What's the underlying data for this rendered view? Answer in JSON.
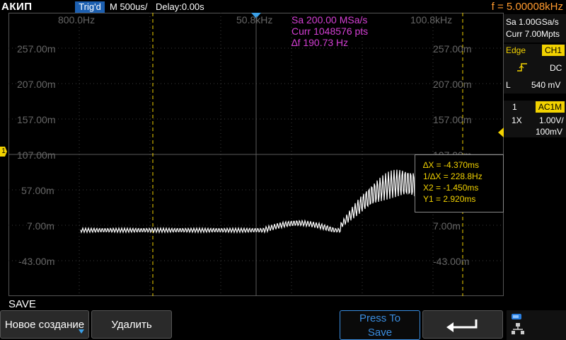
{
  "brand": "АКИП",
  "status": {
    "trig": "Trig'd",
    "timebase": "M 500us/",
    "delay": "Delay:0.00s",
    "freq": "f = 5.00008kHz"
  },
  "fft": {
    "x_labels": [
      "800.0Hz",
      "50.8kHz",
      "100.8kHz"
    ],
    "y_labels_left": [
      "257.00m",
      "207.00m",
      "157.00m",
      "107.00m",
      "57.00m",
      "7.00m",
      "-43.00m"
    ],
    "y_labels_right": [
      "257.00m",
      "207.00m",
      "157.00m",
      "107.00m",
      "57.00m",
      "7.00m",
      "-43.00m"
    ],
    "sa": "Sa 200.00 MSa/s",
    "curr": "Curr 1048576 pts",
    "df": "∆f 190.73 Hz",
    "trace_color": "#ffffff"
  },
  "channel_marker": "1",
  "right_panel": {
    "sa": "Sa 1.00GSa/s",
    "curr": "Curr 7.00Mpts",
    "edge_label": "Edge",
    "edge_channel": "CH1",
    "coupling": "DC",
    "level_label": "L",
    "level_value": "540 mV",
    "ch_number": "1",
    "ch_coupling": "AC1M",
    "probe": "1X",
    "volts_div": "1.00V/",
    "offset": "100mV"
  },
  "cursors": {
    "dx": "∆X = -4.370ms",
    "inv_dx": "1/∆X = 228.8Hz",
    "x2": "X2 = -1.450ms",
    "y1": "Y1 = 2.920ms"
  },
  "menu": {
    "title": "SAVE",
    "new_label": "Новое создание",
    "delete_label": "Удалить",
    "press_to_save_line1": "Press To",
    "press_to_save_line2": "Save",
    "back_icon": "return-arrow-icon",
    "network_icon": "network-icon"
  },
  "colors": {
    "accent_blue": "#1c5fb0",
    "freq_orange": "#ff9a2e",
    "channel_yellow": "#f2d200",
    "fft_magenta": "#d43fd4"
  }
}
